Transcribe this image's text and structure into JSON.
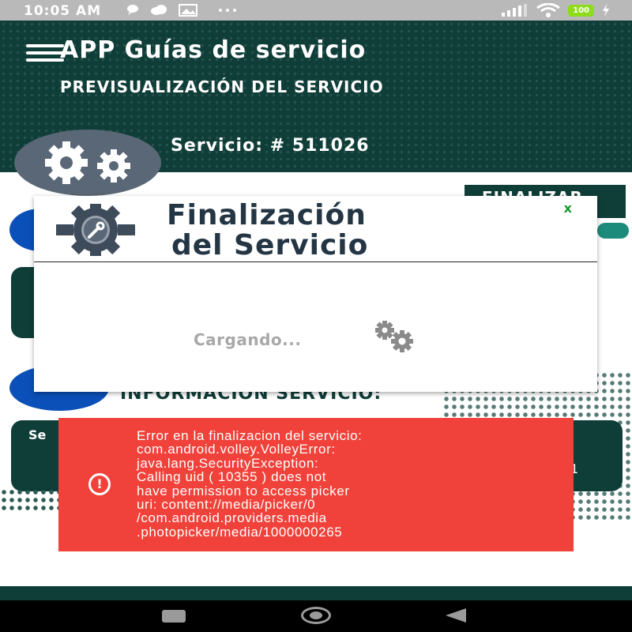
{
  "status_bar": {
    "time": "10:05 AM",
    "battery": "100"
  },
  "header": {
    "app_title": "APP Guías de servicio",
    "subtitle": "PREVISUALIZACIÓN DEL SERVICIO",
    "service_number": "Servicio: # 511026"
  },
  "background": {
    "finalize_button_label": "FINALIZAR",
    "info_heading": "INFORMACION SERVICIO:",
    "card_label": "Se",
    "card_right": "1"
  },
  "modal": {
    "title_line1": "Finalización",
    "title_line2": "del Servicio",
    "close_label": "x",
    "loading_text": "Cargando..."
  },
  "toast": {
    "icon": "error-icon",
    "message": "Error en la finalizacion del servicio:\ncom.android.volley.VolleyError:\njava.lang.SecurityException:\nCalling uid ( 10355 ) does not\nhave permission to access picker\nuri: content://media/picker/0\n/com.android.providers.media\n.photopicker/media/1000000265"
  },
  "colors": {
    "header_bg": "#0f3d38",
    "toast_bg": "#f0423a",
    "modal_title": "#243544",
    "close_green": "#1a9a2a"
  }
}
